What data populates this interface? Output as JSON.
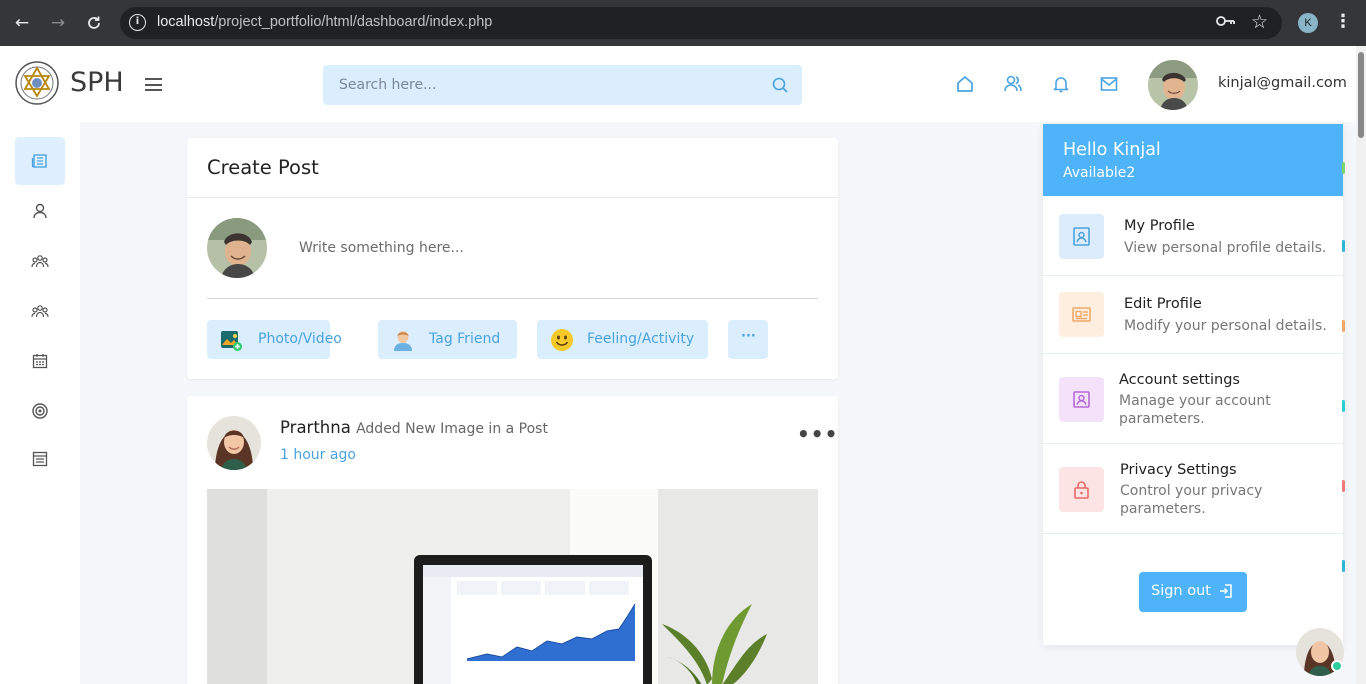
{
  "browser": {
    "url_host": "localhost",
    "url_path": "/project_portfolio/html/dashboard/index.php",
    "profile_initial": "K"
  },
  "header": {
    "brand": "SPH",
    "search_placeholder": "Search here...",
    "user_email": "kinjal@gmail.com",
    "icons": [
      "home-icon",
      "users-icon",
      "bell-icon",
      "mail-icon"
    ]
  },
  "sidebar": {
    "items": [
      "newspaper-icon",
      "user-icon",
      "group-icon",
      "group-icon",
      "calendar-icon",
      "target-icon",
      "list-icon"
    ]
  },
  "create_post": {
    "title": "Create Post",
    "input_placeholder": "Write something here...",
    "buttons": [
      {
        "label": "Photo/Video",
        "icon": "photo-icon"
      },
      {
        "label": "Tag Friend",
        "icon": "tag-friend-icon"
      },
      {
        "label": "Feeling/Activity",
        "icon": "smiley-icon"
      },
      {
        "label": "···",
        "icon": "more-icon"
      }
    ]
  },
  "post": {
    "author": "Prarthna",
    "action": "Added New Image in a Post",
    "time": "1 hour ago",
    "more": "•••"
  },
  "dropdown": {
    "greeting": "Hello Kinjal",
    "status": "Available2",
    "items": [
      {
        "title": "My Profile",
        "desc": "View personal profile details.",
        "icon": "profile-icon"
      },
      {
        "title": "Edit Profile",
        "desc": "Modify your personal details.",
        "icon": "edit-profile-icon"
      },
      {
        "title": "Account settings",
        "desc": "Manage your account parameters.",
        "icon": "account-icon"
      },
      {
        "title": "Privacy Settings",
        "desc": "Control your privacy parameters.",
        "icon": "lock-icon"
      }
    ],
    "signout": "Sign out"
  },
  "colors": {
    "accent": "#4eb3f8",
    "accent_light": "#dbeefd",
    "link": "#4aa3df"
  }
}
